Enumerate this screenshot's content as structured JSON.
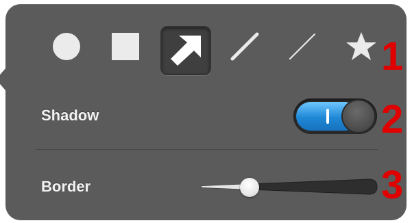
{
  "colors": {
    "panel": "#5b5b5b",
    "icon": "#ebebeb",
    "toggle_on": "#1f88d6",
    "marker": "#e00000"
  },
  "tools": [
    {
      "icon": "circle-icon",
      "selected": false
    },
    {
      "icon": "square-icon",
      "selected": false
    },
    {
      "icon": "arrow-icon",
      "selected": true
    },
    {
      "icon": "thick-line-icon",
      "selected": false
    },
    {
      "icon": "thin-line-icon",
      "selected": false
    },
    {
      "icon": "star-icon",
      "selected": false
    }
  ],
  "shadow": {
    "label": "Shadow",
    "on": true,
    "on_glyph": "I"
  },
  "border": {
    "label": "Border",
    "value": 0.23
  },
  "markers": [
    "1",
    "2",
    "3"
  ]
}
